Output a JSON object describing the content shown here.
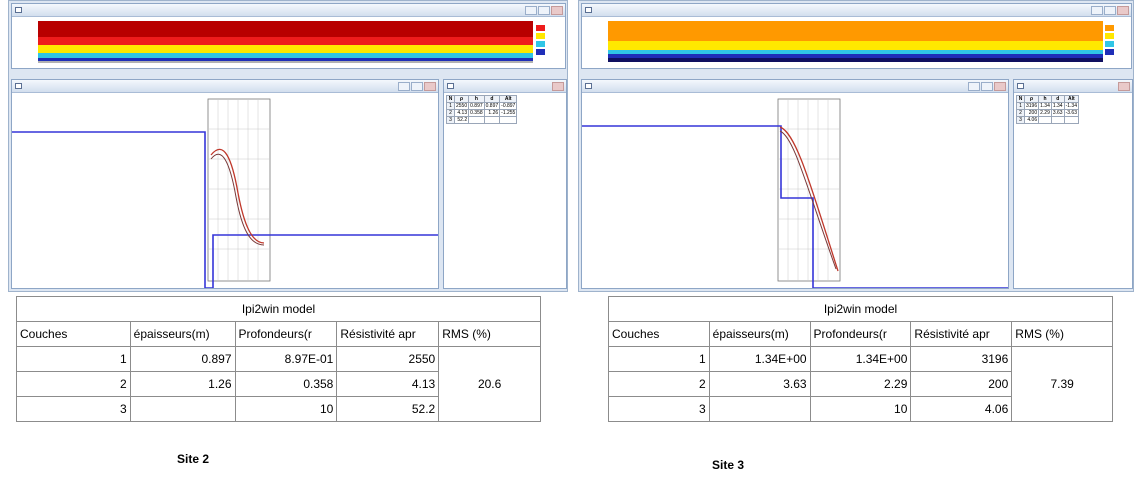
{
  "colors": {
    "panel_bg": "#dde6f2",
    "model_curve": "#3535d8",
    "field_curve": "#c0382b",
    "fit_curve": "#7a3a3a",
    "bar_dark_red": "#b80000",
    "bar_red": "#ee1c1c",
    "bar_orange": "#ff9900",
    "bar_yellow": "#ffe800",
    "bar_cyan": "#30c6e6",
    "bar_blue": "#1f2eb8",
    "bar_navy": "#101060"
  },
  "site2": {
    "label": "Site 2",
    "table": {
      "title": "Ipi2win model",
      "headers": [
        "Couches",
        "épaisseurs(m)",
        "Profondeurs(r",
        "Résistivité apr",
        "RMS (%)"
      ],
      "rows": [
        {
          "layer": "1",
          "thickness": "0.897",
          "depth": "8.97E-01",
          "resistivity": "2550"
        },
        {
          "layer": "2",
          "thickness": "1.26",
          "depth": "0.358",
          "resistivity": "4.13"
        },
        {
          "layer": "3",
          "thickness": "",
          "depth": "10",
          "resistivity": "52.2"
        }
      ],
      "rms": "20.6"
    },
    "mini": {
      "headers": [
        "N",
        "ρ",
        "h",
        "d",
        "Alt"
      ],
      "rows": [
        [
          "1",
          "2550",
          "0.897",
          "0.897",
          "-0.897"
        ],
        [
          "2",
          "4.13",
          "0.358",
          "1.26",
          "-1.255"
        ],
        [
          "3",
          "52.2",
          "",
          "",
          ""
        ]
      ]
    }
  },
  "site3": {
    "label": "Site 3",
    "table": {
      "title": "Ipi2win model",
      "headers": [
        "Couches",
        "épaisseurs(m)",
        "Profondeurs(r",
        "Résistivité apr",
        "RMS (%)"
      ],
      "rows": [
        {
          "layer": "1",
          "thickness": "1.34E+00",
          "depth": "1.34E+00",
          "resistivity": "3196"
        },
        {
          "layer": "2",
          "thickness": "3.63",
          "depth": "2.29",
          "resistivity": "200"
        },
        {
          "layer": "3",
          "thickness": "",
          "depth": "10",
          "resistivity": "4.06"
        }
      ],
      "rms": "7.39"
    },
    "mini": {
      "headers": [
        "N",
        "ρ",
        "h",
        "d",
        "Alt"
      ],
      "rows": [
        [
          "1",
          "3196",
          "1.34",
          "1.34",
          "-1.34"
        ],
        [
          "2",
          "200",
          "2.29",
          "3.63",
          "-3.63"
        ],
        [
          "3",
          "4.06",
          "",
          "",
          ""
        ]
      ]
    }
  }
}
